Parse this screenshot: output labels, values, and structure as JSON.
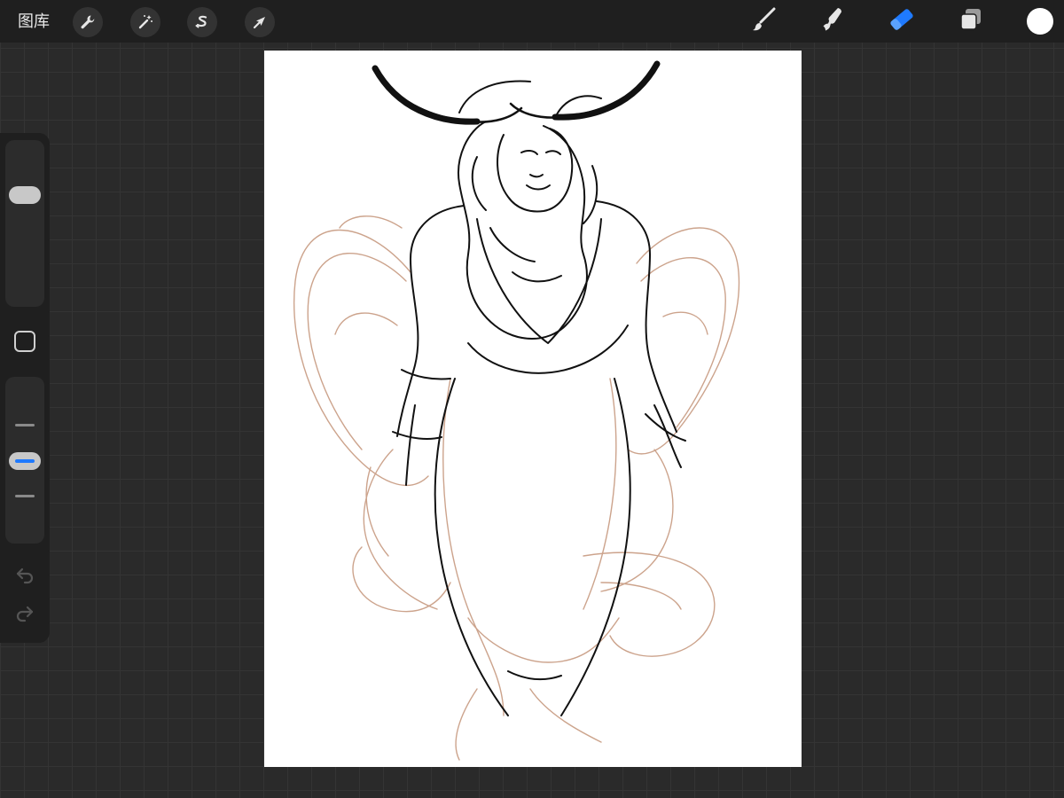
{
  "topbar": {
    "gallery_label": "图库",
    "actions": [
      "wrench-icon",
      "magic-wand-icon",
      "selection-icon",
      "transform-arrow-icon"
    ],
    "tools": [
      "brush-icon",
      "smudge-icon",
      "eraser-icon",
      "layers-icon"
    ],
    "active_tool": "eraser",
    "color_current": "#ffffff",
    "accent_color": "#1f7aff"
  },
  "sidebar": {
    "brush_size_level": 0.2,
    "opacity_level": 0.5,
    "modify_button": "square-icon",
    "undo": "undo-icon",
    "redo": "redo-icon"
  },
  "canvas": {
    "background": "#ffffff",
    "lineart_color": "#111111",
    "sketch_color": "#c79a80"
  }
}
